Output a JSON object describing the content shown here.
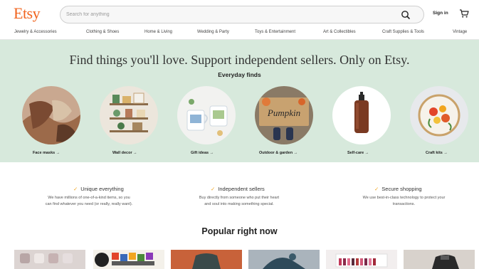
{
  "header": {
    "logo": "Etsy",
    "search_placeholder": "Search for anything",
    "sign_in": "Sign in"
  },
  "nav": {
    "items": [
      "Jewelry & Accessories",
      "Clothing & Shoes",
      "Home & Living",
      "Wedding & Party",
      "Toys & Entertainment",
      "Art & Collectibles",
      "Craft Supplies & Tools",
      "Vintage"
    ]
  },
  "hero": {
    "title": "Find things you'll love. Support independent sellers. Only on Etsy.",
    "subtitle": "Everyday finds",
    "categories": [
      "Face masks →",
      "Wall decor →",
      "Gift ideas →",
      "Outdoor & garden →",
      "Self-care →",
      "Craft kits →"
    ],
    "doormat_text": "Pumpkin"
  },
  "value_props": [
    {
      "title": "Unique everything",
      "desc_line1": "We have millions of one-of-a-kind items, so you",
      "desc_line2": "can find whatever you need (or really, really want)."
    },
    {
      "title": "Independent sellers",
      "desc_line1": "Buy directly from someone who put their heart",
      "desc_line2": "and soul into making something special."
    },
    {
      "title": "Secure shopping",
      "desc_line1": "We use best-in-class technology to protect your",
      "desc_line2": "transactions."
    }
  ],
  "popular": {
    "heading": "Popular right now"
  },
  "colors": {
    "brand": "#f1641e",
    "hero_bg": "#d7e9dc",
    "check": "#f1a51e"
  }
}
